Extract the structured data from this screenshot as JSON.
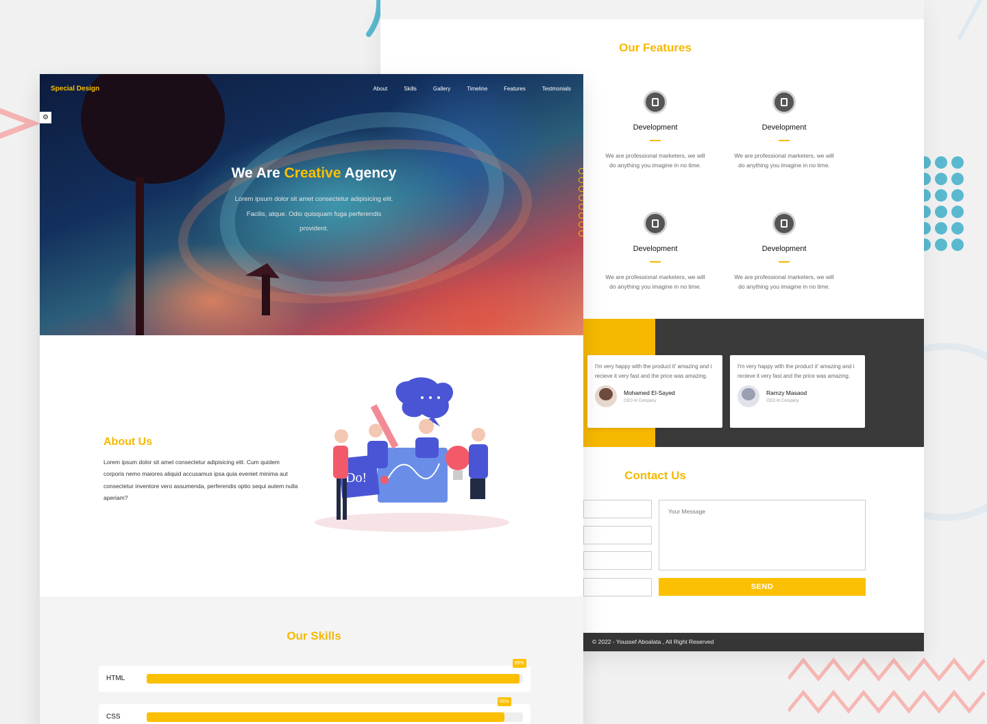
{
  "brand": {
    "logo": "Special Design",
    "accent": "#fcc002",
    "dark": "#363636"
  },
  "nav": {
    "items": [
      "About",
      "Skills",
      "Gallery",
      "Timeline",
      "Features",
      "Testmonials"
    ]
  },
  "hero": {
    "title_prefix": "We Are ",
    "title_highlight": "Creative",
    "title_suffix": " Agency",
    "text": "Lorem ipsum dolor sit amet consectetur adipisicing elit. Facilis, atque. Odio quisquam fuga perferendis provident."
  },
  "about": {
    "title": "About Us",
    "text": "Lorem ipsum dolor sit amet consectetur adipisicing elit. Cum quidem corporis nemo maiores aliquid accusamus ipsa quia eveniet minima aut consectetur inventore vero assumenda, perferendis optio sequi autem nulla aperiam?"
  },
  "skills": {
    "title": "Our Skills",
    "items": [
      {
        "name": "HTML",
        "percent": 99,
        "label": "99%"
      },
      {
        "name": "CSS",
        "percent": 95,
        "label": "95%"
      }
    ]
  },
  "features": {
    "title": "Our Features",
    "items": [
      {
        "icon": "database-icon",
        "title": "Development",
        "text": "We are professional marketers, we will do anything you imagine in no time."
      },
      {
        "icon": "document-icon",
        "title": "Development",
        "text": "We are professional marketers, we will do anything you imagine in no time."
      },
      {
        "icon": "copy-icon",
        "title": "Development",
        "text": "We are professional marketers, we will do anything you imagine in no time."
      },
      {
        "icon": "calendar-icon",
        "title": "Development",
        "text": "We are professional marketers, we will do anything you imagine in no time."
      }
    ]
  },
  "testimonials": [
    {
      "quote": "I'm very happy with the product it' amazing and i recieve it very fast and the price was amazing.",
      "name": "Mohamed El-Sayed",
      "role": "CEO At Company"
    },
    {
      "quote": "I'm very happy with the product it' amazing and i recieve it very fast and the price was amazing.",
      "name": "Ramzy Masaod",
      "role": "CEO At Company"
    }
  ],
  "contact": {
    "title": "Contact Us",
    "message_placeholder": "Your Message",
    "send_label": "SEND"
  },
  "footer": {
    "text": "© 2022 - Youssef Aboalata , All Right Reserved"
  }
}
